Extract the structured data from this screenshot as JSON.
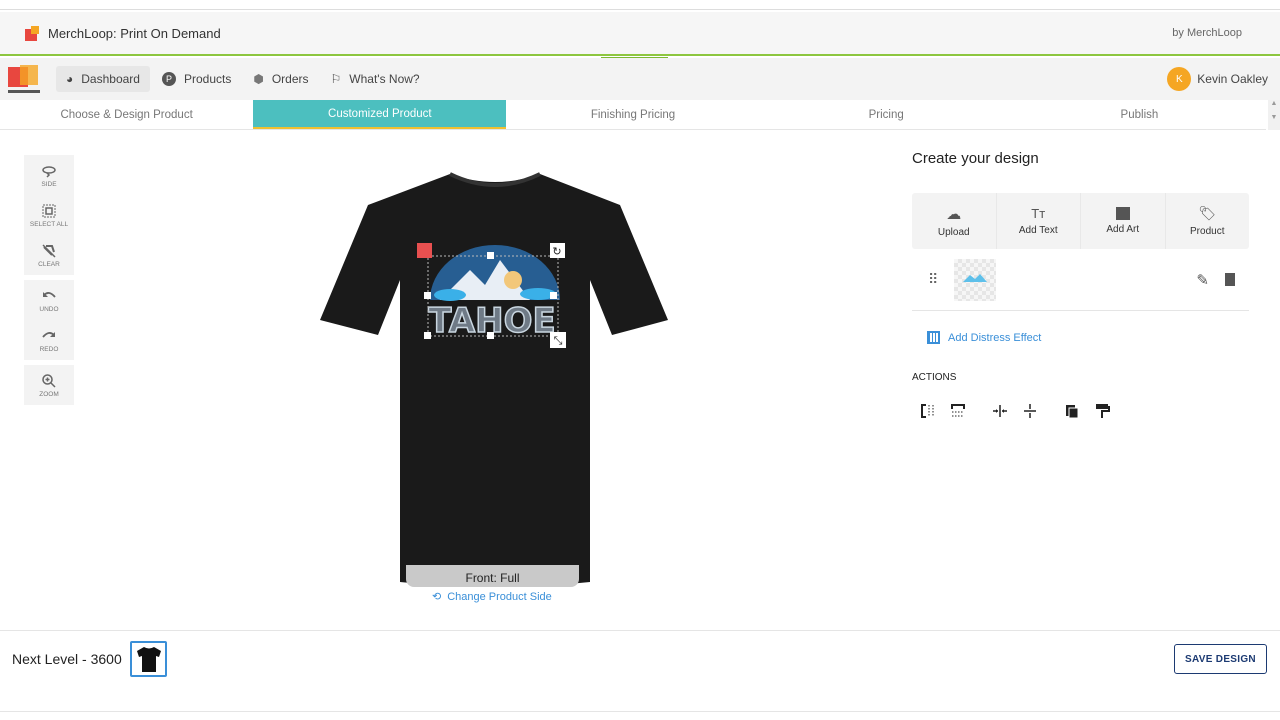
{
  "app": {
    "title": "MerchLoop: Print On Demand",
    "by": "by MerchLoop",
    "theme_badge": "viva-dark-black"
  },
  "nav": {
    "items": [
      {
        "label": "Dashboard",
        "icon": "dashboard-icon"
      },
      {
        "label": "Products",
        "icon": "products-icon"
      },
      {
        "label": "Orders",
        "icon": "orders-icon"
      },
      {
        "label": "What's Now?",
        "icon": "flag-icon"
      }
    ],
    "user": {
      "initial": "K",
      "name": "Kevin Oakley"
    }
  },
  "steps": [
    {
      "label": "Choose & Design Product"
    },
    {
      "label": "Customized Product",
      "active": true
    },
    {
      "label": "Finishing Pricing"
    },
    {
      "label": "Pricing"
    },
    {
      "label": "Publish"
    }
  ],
  "tools": {
    "side": "SIDE",
    "select_all": "SELECT ALL",
    "clear": "CLEAR",
    "undo": "UNDO",
    "redo": "REDO",
    "zoom": "ZOOM"
  },
  "canvas": {
    "design_text": "TAHOE",
    "side_label": "Front: Full",
    "change_side": "Change Product Side",
    "shirt_color": "#1a1a1a"
  },
  "panel": {
    "title": "Create your design",
    "buttons": {
      "upload": "Upload",
      "add_text": "Add Text",
      "add_art": "Add Art",
      "product": "Product"
    },
    "distress": "Add Distress Effect",
    "actions_label": "ACTIONS"
  },
  "footer": {
    "product_name": "Next Level - 3600",
    "save": "SAVE DESIGN"
  },
  "colors": {
    "accent": "#4cbfbf",
    "link": "#3a8fd8",
    "brand_green": "#8dc63f"
  }
}
